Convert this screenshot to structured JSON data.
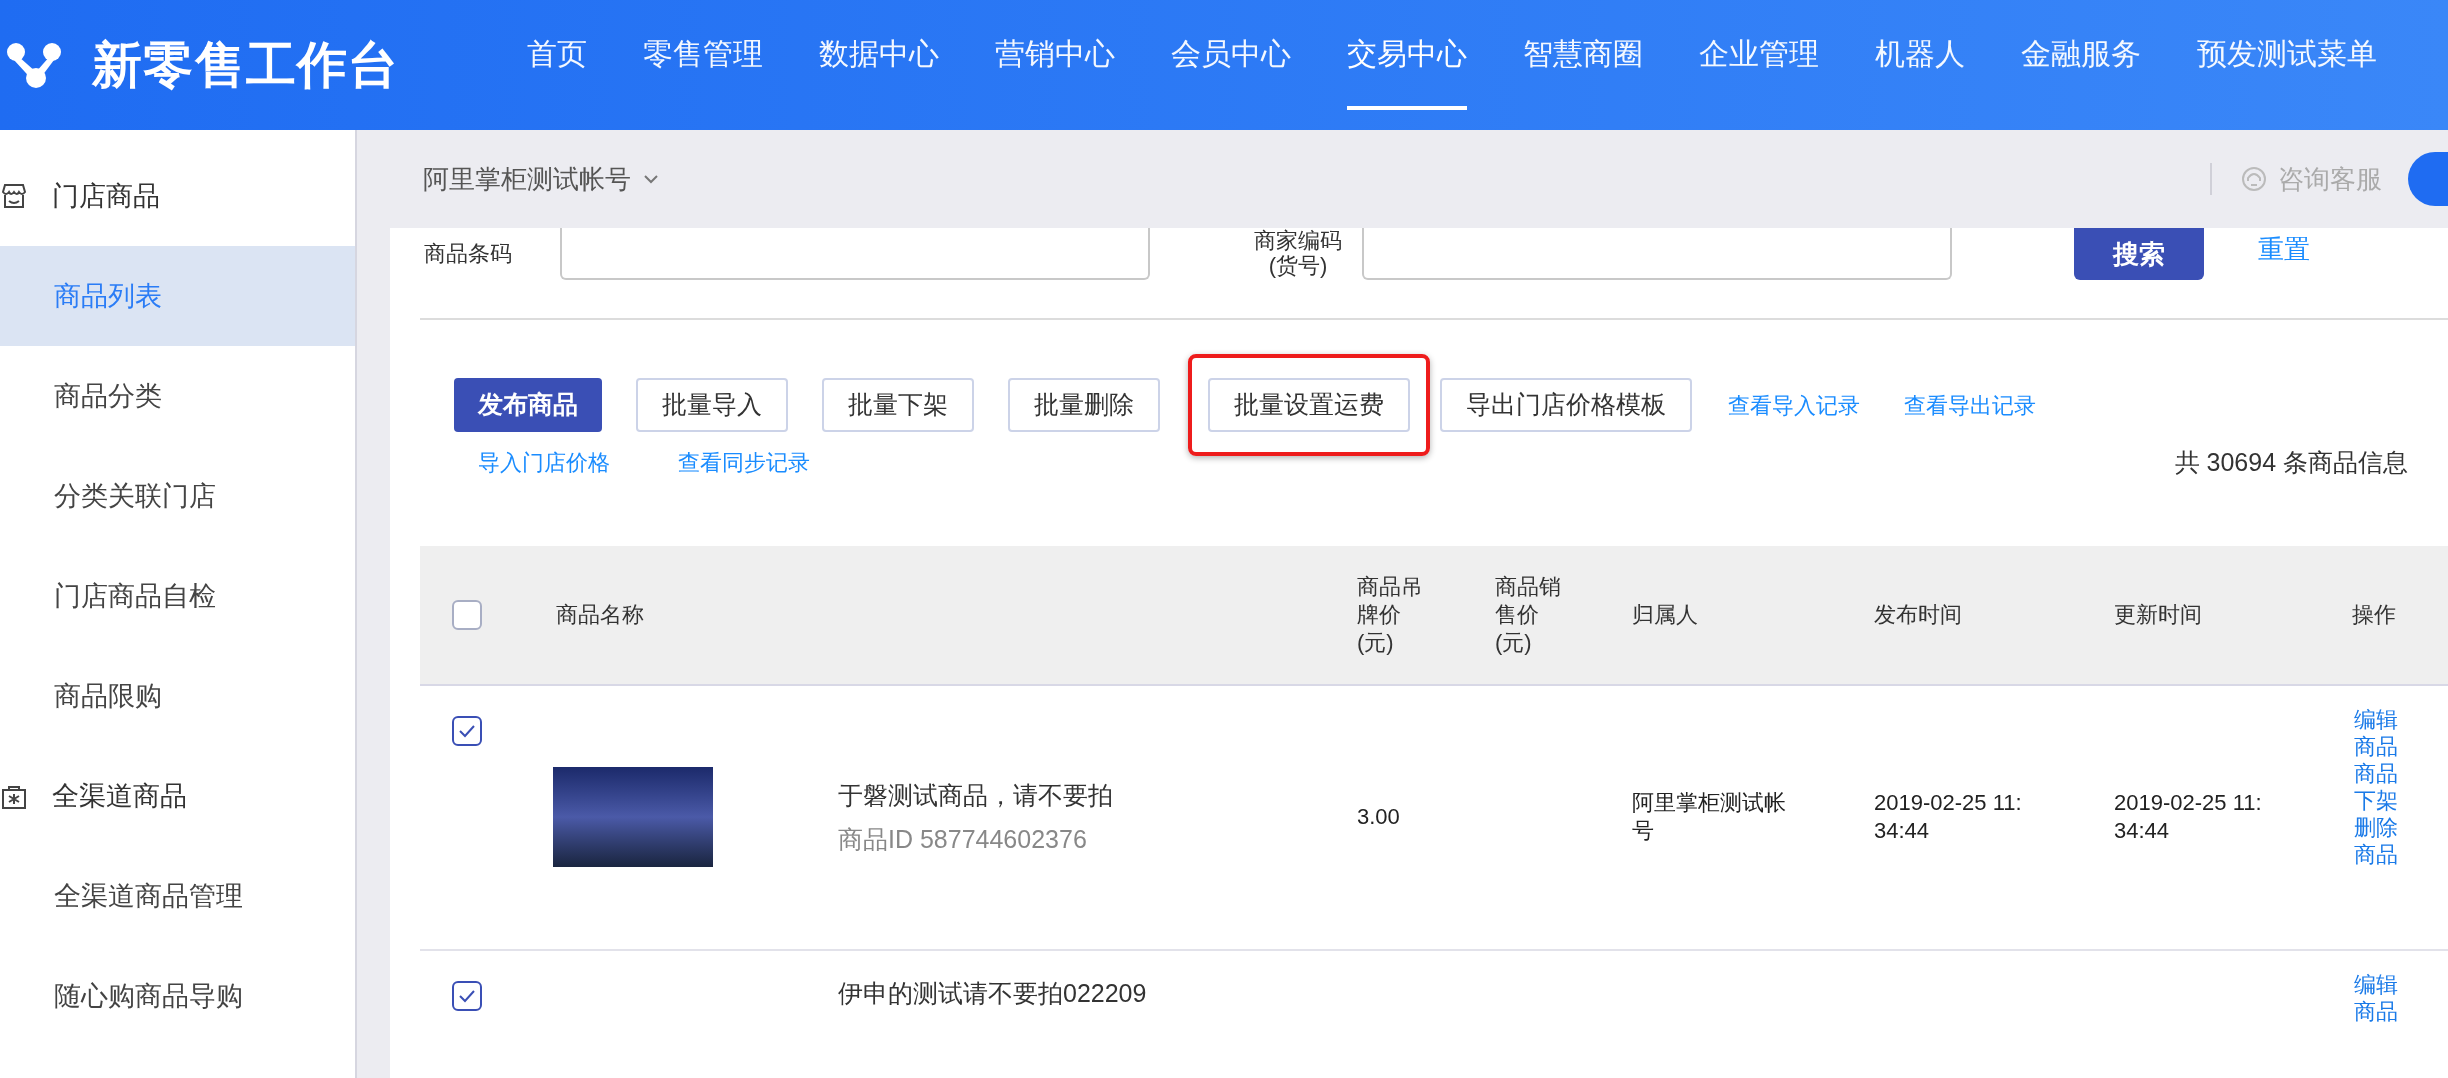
{
  "header": {
    "logo": "新零售工作台",
    "nav": [
      {
        "label": "首页",
        "selected": false
      },
      {
        "label": "零售管理",
        "selected": false
      },
      {
        "label": "数据中心",
        "selected": false
      },
      {
        "label": "营销中心",
        "selected": false
      },
      {
        "label": "会员中心",
        "selected": false
      },
      {
        "label": "交易中心",
        "selected": true
      },
      {
        "label": "智慧商圈",
        "selected": false
      },
      {
        "label": "企业管理",
        "selected": false
      },
      {
        "label": "机器人",
        "selected": false
      },
      {
        "label": "金融服务",
        "selected": false
      },
      {
        "label": "预发测试菜单",
        "selected": false
      }
    ]
  },
  "sidebar": {
    "groups": [
      {
        "title": "门店商品",
        "items": [
          {
            "label": "商品列表",
            "selected": true
          },
          {
            "label": "商品分类",
            "selected": false
          },
          {
            "label": "分类关联门店",
            "selected": false
          },
          {
            "label": "门店商品自检",
            "selected": false
          },
          {
            "label": "商品限购",
            "selected": false
          }
        ]
      },
      {
        "title": "全渠道商品",
        "items": [
          {
            "label": "全渠道商品管理",
            "selected": false
          },
          {
            "label": "随心购商品导购",
            "selected": false
          }
        ]
      }
    ]
  },
  "topbar": {
    "account": "阿里掌柜测试帐号",
    "help": "咨询客服"
  },
  "filters": [
    {
      "label": "商品条码"
    },
    {
      "label": "商家编码(货号)"
    }
  ],
  "search_button": "搜索",
  "reset_link": "重置",
  "actions": {
    "buttons": [
      {
        "label": "发布商品",
        "kind": "primary",
        "highlighted": false
      },
      {
        "label": "批量导入",
        "kind": "default",
        "highlighted": false
      },
      {
        "label": "批量下架",
        "kind": "default",
        "highlighted": false
      },
      {
        "label": "批量删除",
        "kind": "default",
        "highlighted": false
      },
      {
        "label": "批量设置运费",
        "kind": "default",
        "highlighted": true
      },
      {
        "label": "导出门店价格模板",
        "kind": "default",
        "highlighted": false
      }
    ],
    "links": [
      "查看导入记录",
      "查看导出记录"
    ],
    "sub_links": [
      "导入门店价格",
      "查看同步记录"
    ],
    "total": "共 30694 条商品信息"
  },
  "table": {
    "header_checked": false,
    "columns": [
      "商品名称",
      "商品吊牌价(元)",
      "商品销售价(元)",
      "归属人",
      "发布时间",
      "更新时间",
      "操作"
    ],
    "rows": [
      {
        "checked": true,
        "name": "于磐测试商品，请不要拍",
        "product_id": "商品ID 587744602376",
        "tag_price": "3.00",
        "owner": "阿里掌柜测试帐号",
        "published": "2019-02-25 11:34:44",
        "updated": "2019-02-25 11:34:44",
        "actions": [
          "编辑商品",
          "商品下架",
          "删除商品"
        ]
      },
      {
        "checked": true,
        "name": "伊申的测试请不要拍022209",
        "actions": [
          "编辑商品"
        ]
      }
    ]
  }
}
